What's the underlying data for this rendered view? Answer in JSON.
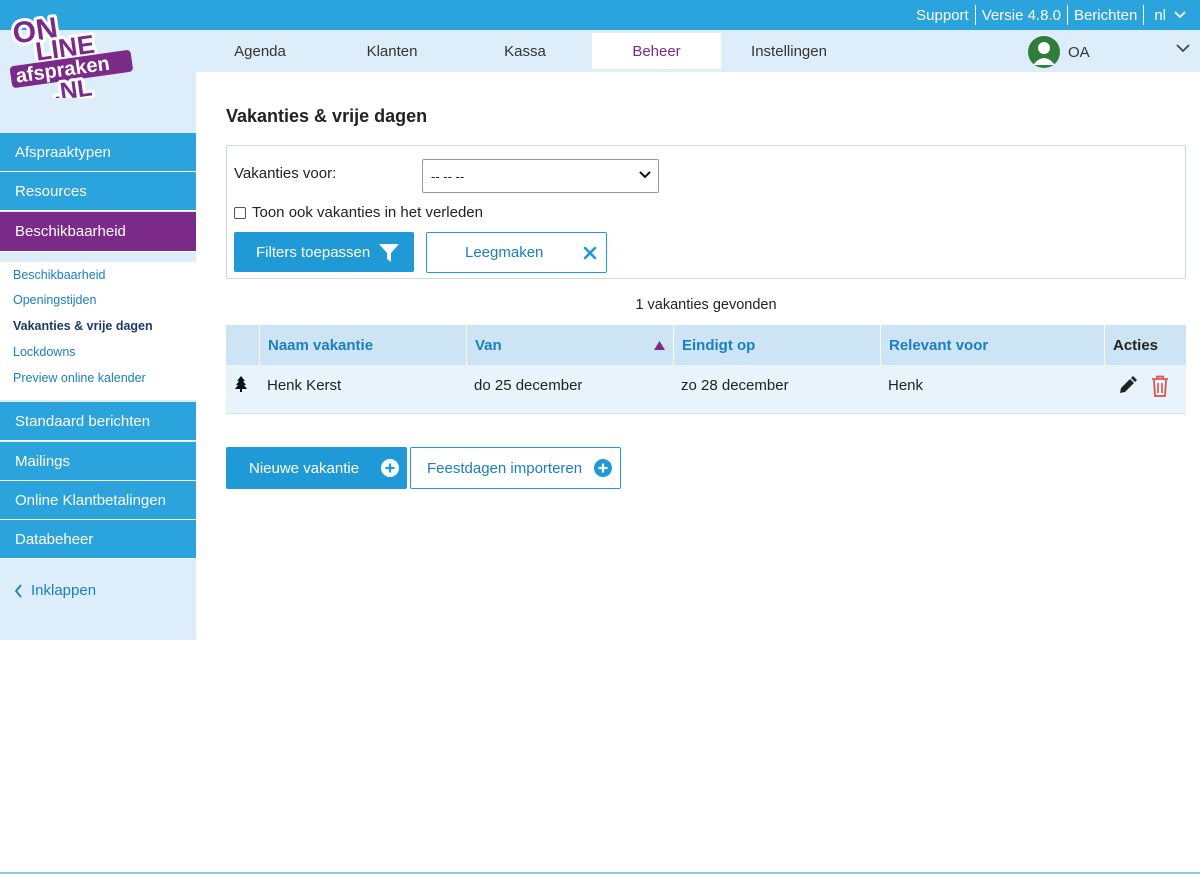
{
  "brand": {
    "logo_line1": "ON",
    "logo_line2": "LINE",
    "logo_line3": "afspraken",
    "logo_line4": ".NL",
    "logo_color": "#7b2a8a"
  },
  "toplinks": {
    "support": "Support",
    "version": "Versie 4.8.0",
    "messages": "Berichten",
    "language": "nl"
  },
  "nav": {
    "items": [
      {
        "label": "Agenda"
      },
      {
        "label": "Klanten"
      },
      {
        "label": "Kassa"
      },
      {
        "label": "Beheer"
      },
      {
        "label": "Instellingen"
      }
    ],
    "active": "Beheer",
    "user_initials": "OA"
  },
  "sidebar": {
    "top_items": [
      {
        "label": "Afspraaktypen"
      },
      {
        "label": "Resources"
      },
      {
        "label": "Beschikbaarheid"
      }
    ],
    "sub_items": [
      {
        "label": "Beschikbaarheid"
      },
      {
        "label": "Openingstijden"
      },
      {
        "label": "Vakanties & vrije dagen"
      },
      {
        "label": "Lockdowns"
      },
      {
        "label": "Preview online kalender"
      }
    ],
    "bottom_items": [
      {
        "label": "Standaard berichten"
      },
      {
        "label": "Mailings"
      },
      {
        "label": "Online Klantbetalingen"
      },
      {
        "label": "Databeheer"
      }
    ],
    "collapse_label": "Inklappen"
  },
  "main": {
    "title": "Vakanties & vrije dagen",
    "filter": {
      "label": "Vakanties voor:",
      "select_value": "-- -- --",
      "checkbox_label": "Toon ook vakanties in het verleden",
      "checkbox_checked": false,
      "apply_label": "Filters toepassen",
      "clear_label": "Leegmaken"
    },
    "result_count": "1 vakanties gevonden",
    "table": {
      "headers": [
        "Naam vakantie",
        "Van",
        "Eindigt op",
        "Relevant voor",
        "Acties"
      ],
      "sorted_column": "Van",
      "sort_direction": "ascending",
      "rows": [
        {
          "name": "Henk Kerst",
          "from": "do 25 december",
          "until": "zo 28 december",
          "relevant": "Henk",
          "icon": "tree-icon"
        }
      ]
    },
    "new_label": "Nieuwe vakantie",
    "import_label": "Feestdagen importeren"
  },
  "colors": {
    "primary": "#2ba3dc",
    "accent": "#7b2a8a",
    "nav_bg": "#ddeefa",
    "delete": "#d9534f",
    "avatar": "#2e7d3a"
  }
}
